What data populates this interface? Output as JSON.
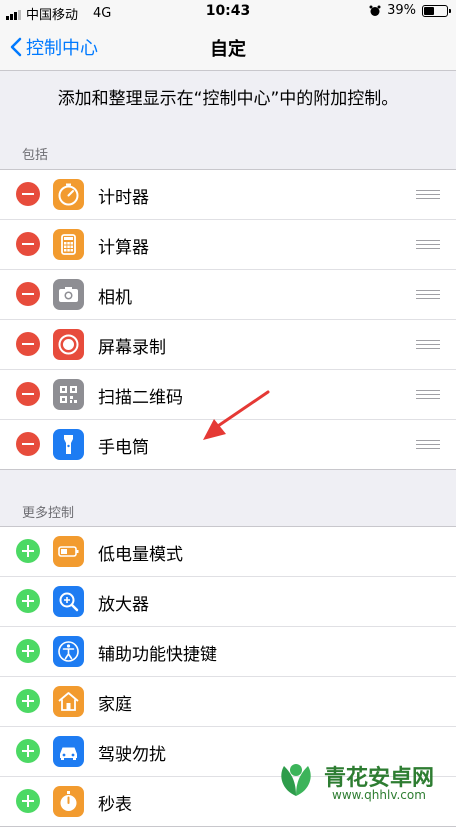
{
  "status": {
    "carrier": "中国移动",
    "network": "4G",
    "time": "10:43",
    "battery": "39%"
  },
  "nav": {
    "back_label": "控制中心",
    "title": "自定"
  },
  "description": "添加和整理显示在“控制中心”中的附加控制。",
  "included": {
    "header": "包括",
    "items": [
      {
        "label": "计时器",
        "icon": "timer-icon",
        "color": "#f29b2f"
      },
      {
        "label": "计算器",
        "icon": "calculator-icon",
        "color": "#f29b2f"
      },
      {
        "label": "相机",
        "icon": "camera-icon",
        "color": "#8e8e93"
      },
      {
        "label": "屏幕录制",
        "icon": "screen-record-icon",
        "color": "#e74c3c"
      },
      {
        "label": "扫描二维码",
        "icon": "qr-code-icon",
        "color": "#8e8e93"
      },
      {
        "label": "手电筒",
        "icon": "flashlight-icon",
        "color": "#1e7cf2"
      }
    ]
  },
  "more": {
    "header": "更多控制",
    "items": [
      {
        "label": "低电量模式",
        "icon": "low-power-icon",
        "color": "#f29b2f"
      },
      {
        "label": "放大器",
        "icon": "magnifier-icon",
        "color": "#1e7cf2"
      },
      {
        "label": "辅助功能快捷键",
        "icon": "accessibility-icon",
        "color": "#1e7cf2"
      },
      {
        "label": "家庭",
        "icon": "home-icon",
        "color": "#f29b2f"
      },
      {
        "label": "驾驶勿扰",
        "icon": "car-icon",
        "color": "#1e7cf2"
      },
      {
        "label": "秒表",
        "icon": "stopwatch-icon",
        "color": "#f29b2f"
      }
    ]
  }
}
